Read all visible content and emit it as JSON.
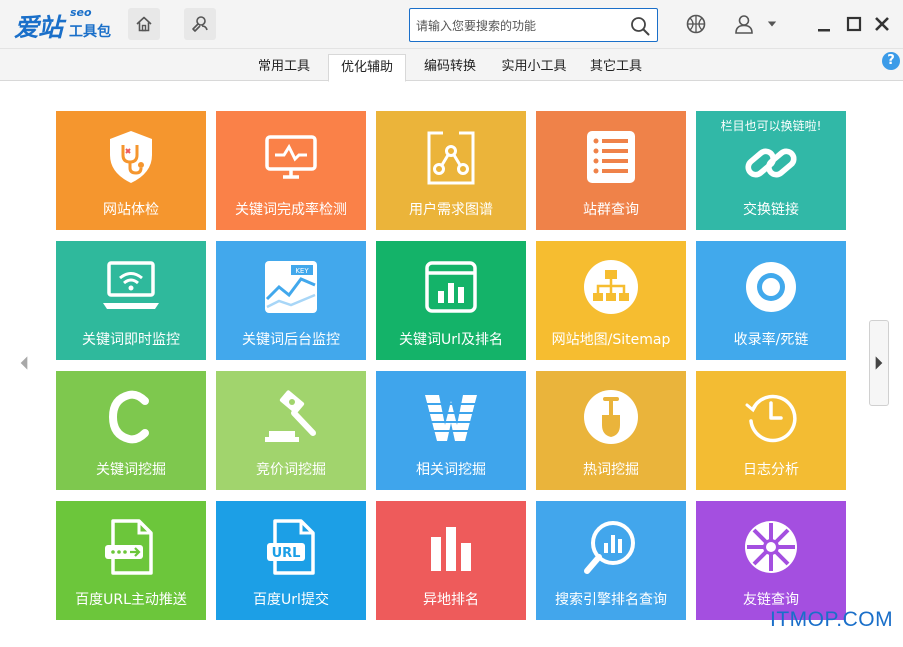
{
  "app": {
    "logo_main": "爱站",
    "logo_seo": "seo",
    "logo_sub": "工具包"
  },
  "search": {
    "placeholder": "请输入您要搜索的功能"
  },
  "tabs": [
    {
      "label": "常用工具",
      "active": false
    },
    {
      "label": "优化辅助",
      "active": true
    },
    {
      "label": "编码转换",
      "active": false
    },
    {
      "label": "实用小工具",
      "active": false
    },
    {
      "label": "其它工具",
      "active": false
    }
  ],
  "help_label": "?",
  "tiles": [
    {
      "label": "网站体检",
      "color": "#f5962e",
      "icon": "shield-stethoscope-icon"
    },
    {
      "label": "关键词完成率检测",
      "color": "#fa8148",
      "icon": "monitor-pulse-icon"
    },
    {
      "label": "用户需求图谱",
      "color": "#ebb43a",
      "icon": "graph-nodes-icon"
    },
    {
      "label": "站群查询",
      "color": "#ef8249",
      "icon": "list-icon"
    },
    {
      "label": "交换链接",
      "color": "#31b8a7",
      "icon": "link-icon",
      "note": "栏目也可以换链啦!"
    },
    {
      "label": "关键词即时监控",
      "color": "#2fb99c",
      "icon": "laptop-wifi-icon"
    },
    {
      "label": "关键词后台监控",
      "color": "#42a8ec",
      "icon": "chart-key-icon"
    },
    {
      "label": "关键词Url及排名",
      "color": "#14b369",
      "icon": "bar-chart-window-icon"
    },
    {
      "label": "网站地图/Sitemap",
      "color": "#f6bd30",
      "icon": "sitemap-icon"
    },
    {
      "label": "收录率/死链",
      "color": "#41a9ec",
      "icon": "ring-icon"
    },
    {
      "label": "关键词挖掘",
      "color": "#7ec84e",
      "icon": "letter-c-icon"
    },
    {
      "label": "竞价词挖掘",
      "color": "#a1d46d",
      "icon": "gavel-icon"
    },
    {
      "label": "相关词挖掘",
      "color": "#3fa5ec",
      "icon": "letter-w-icon"
    },
    {
      "label": "热词挖掘",
      "color": "#eab43b",
      "icon": "shovel-icon"
    },
    {
      "label": "日志分析",
      "color": "#f3bc33",
      "icon": "clock-icon"
    },
    {
      "label": "百度URL主动推送",
      "color": "#6cc63b",
      "icon": "file-arrow-icon"
    },
    {
      "label": "百度Url提交",
      "color": "#1c9fe6",
      "icon": "file-url-icon"
    },
    {
      "label": "异地排名",
      "color": "#ee5b5b",
      "icon": "bars-icon"
    },
    {
      "label": "搜索引擎排名查询",
      "color": "#42a6ec",
      "icon": "magnifier-chart-icon"
    },
    {
      "label": "友链查询",
      "color": "#a44fe0",
      "icon": "wheel-icon"
    }
  ],
  "watermark": "ITMOP.COM"
}
